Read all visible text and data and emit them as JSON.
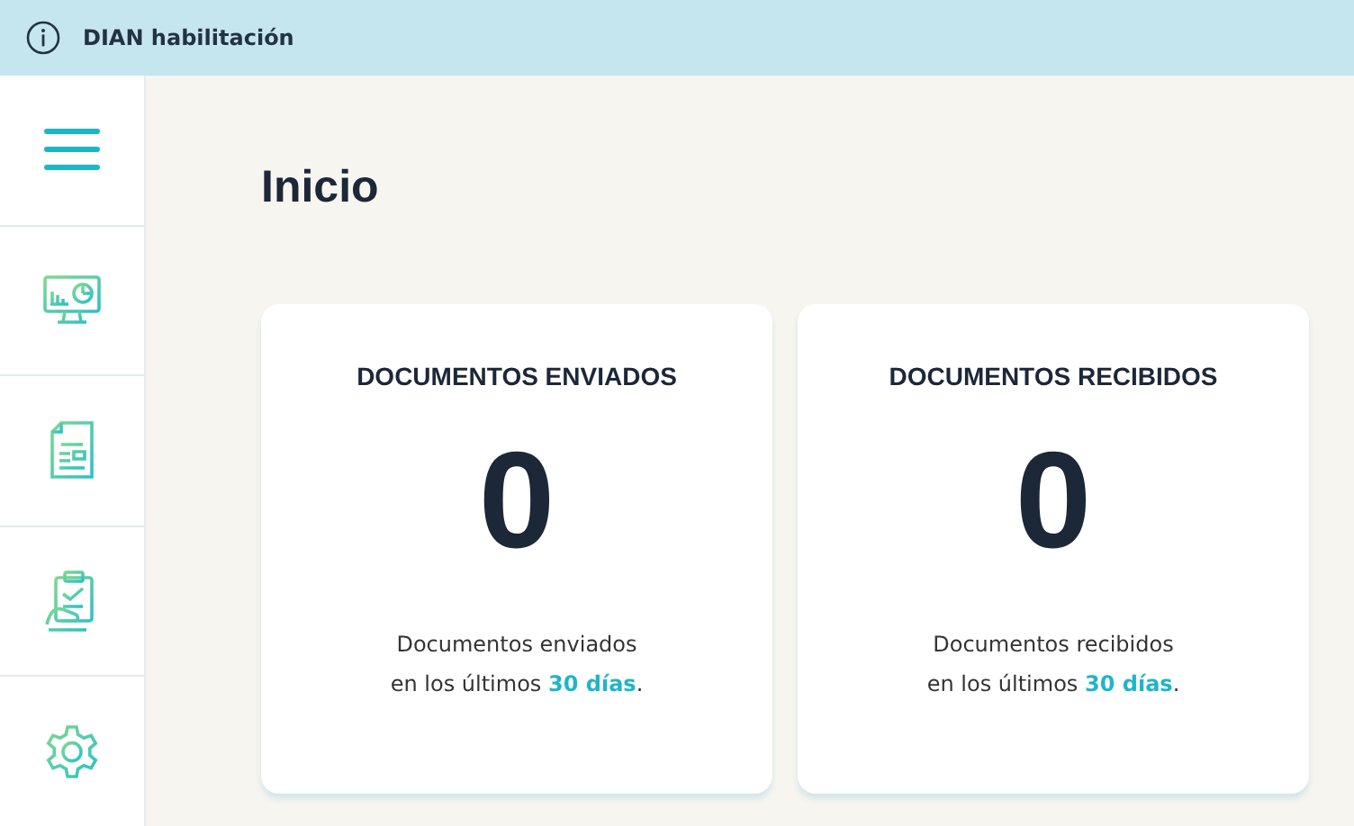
{
  "top_bar": {
    "title": "DIAN habilitación"
  },
  "sidebar": {
    "items": [
      {
        "kind": "menu"
      },
      {
        "kind": "dashboard"
      },
      {
        "kind": "document"
      },
      {
        "kind": "clipboard"
      },
      {
        "kind": "settings"
      }
    ]
  },
  "page_title": "Inicio",
  "cards": [
    {
      "title": "DOCUMENTOS ENVIADOS",
      "count": "0",
      "description_lines": [
        "Documentos enviados",
        "en los últimos **30 días**."
      ]
    },
    {
      "title": "DOCUMENTOS RECIBIDOS",
      "count": "0",
      "description_lines": [
        "Documentos recibidos",
        "en los últimos **30 días**."
      ]
    }
  ]
}
